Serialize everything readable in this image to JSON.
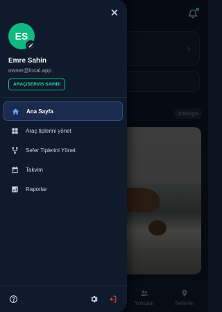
{
  "drawer": {
    "close_icon": "close-icon",
    "user": {
      "initials": "ES",
      "name": "Emre Sahin",
      "email": "owner@local.app",
      "role": "ARAÇ/SERVIS SAHIBI"
    },
    "menu": [
      {
        "label": "Ana Sayfa",
        "icon": "home-icon",
        "active": true
      },
      {
        "label": "Araç tiplerini yönet",
        "icon": "grid-icon",
        "active": false
      },
      {
        "label": "Sefer Tiplerini Yönet",
        "icon": "fork-icon",
        "active": false
      },
      {
        "label": "Takvim",
        "icon": "calendar-icon",
        "active": false
      },
      {
        "label": "Raporlar",
        "icon": "chart-icon",
        "active": false
      }
    ],
    "footer": {
      "help_icon": "help-icon",
      "settings_icon": "gear-icon",
      "logout_icon": "logout-icon"
    }
  },
  "background": {
    "tag": "#design",
    "nav": [
      {
        "label": "Yolcular",
        "icon": "users-icon"
      },
      {
        "label": "Seferler",
        "icon": "pin-icon"
      }
    ]
  },
  "colors": {
    "accent": "#10b981",
    "active_bg": "#1b2b4d",
    "logout": "#ef4444"
  }
}
